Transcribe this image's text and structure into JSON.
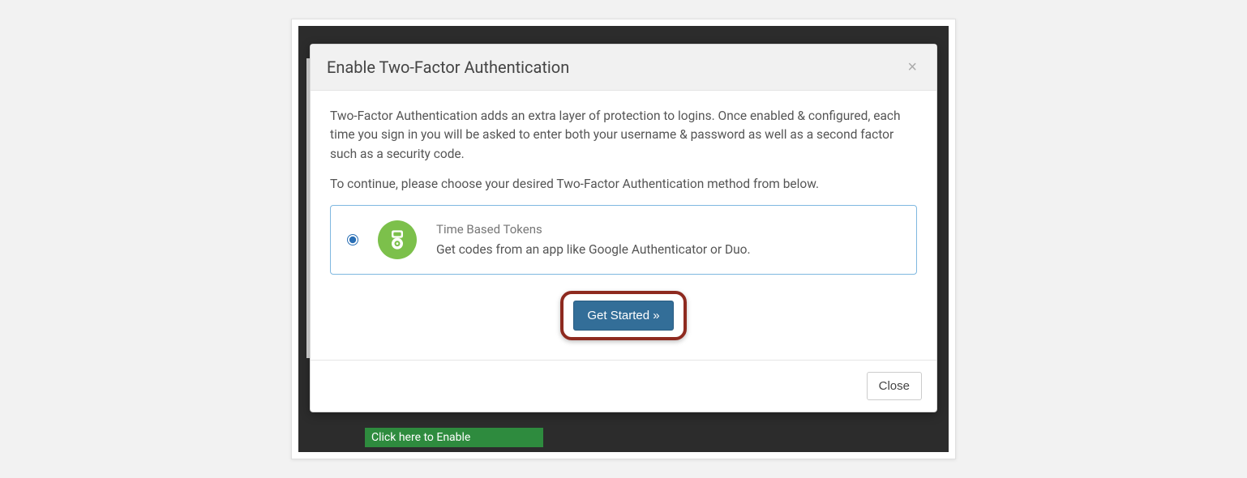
{
  "modal": {
    "title": "Enable Two-Factor Authentication",
    "para1": "Two-Factor Authentication adds an extra layer of protection to logins. Once enabled & configured, each time you sign in you will be asked to enter both your username & password as well as a second factor such as a security code.",
    "para2": "To continue, please choose your desired Two-Factor Authentication method from below.",
    "option": {
      "title": "Time Based Tokens",
      "desc": "Get codes from an app like Google Authenticator or Duo."
    },
    "get_started_label": "Get Started »",
    "close_label": "Close"
  },
  "backdrop": {
    "green_label": "Click here to Enable"
  }
}
